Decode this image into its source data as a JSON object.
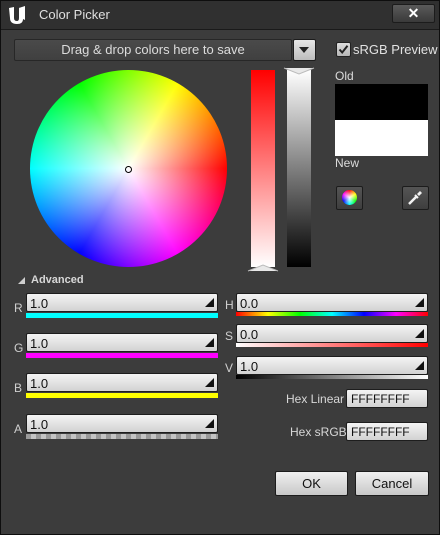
{
  "window": {
    "title": "Color Picker",
    "close_symbol": "✕"
  },
  "palette": {
    "drop_label": "Drag & drop colors here to save"
  },
  "srgb_preview": {
    "label": "sRGB Preview",
    "checked": true
  },
  "preview": {
    "old_label": "Old",
    "new_label": "New",
    "old_color": "#000000",
    "new_color": "#FFFFFF"
  },
  "advanced": {
    "label": "Advanced"
  },
  "rgba": {
    "r": {
      "label": "R",
      "value": "1.0"
    },
    "g": {
      "label": "G",
      "value": "1.0"
    },
    "b": {
      "label": "B",
      "value": "1.0"
    },
    "a": {
      "label": "A",
      "value": "1.0"
    }
  },
  "hsv": {
    "h": {
      "label": "H",
      "value": "0.0"
    },
    "s": {
      "label": "S",
      "value": "0.0"
    },
    "v": {
      "label": "V",
      "value": "1.0"
    }
  },
  "hex": {
    "linear_label": "Hex Linear",
    "linear_value": "FFFFFFFF",
    "srgb_label": "Hex sRGB",
    "srgb_value": "FFFFFFFF"
  },
  "buttons": {
    "ok": "OK",
    "cancel": "Cancel"
  }
}
